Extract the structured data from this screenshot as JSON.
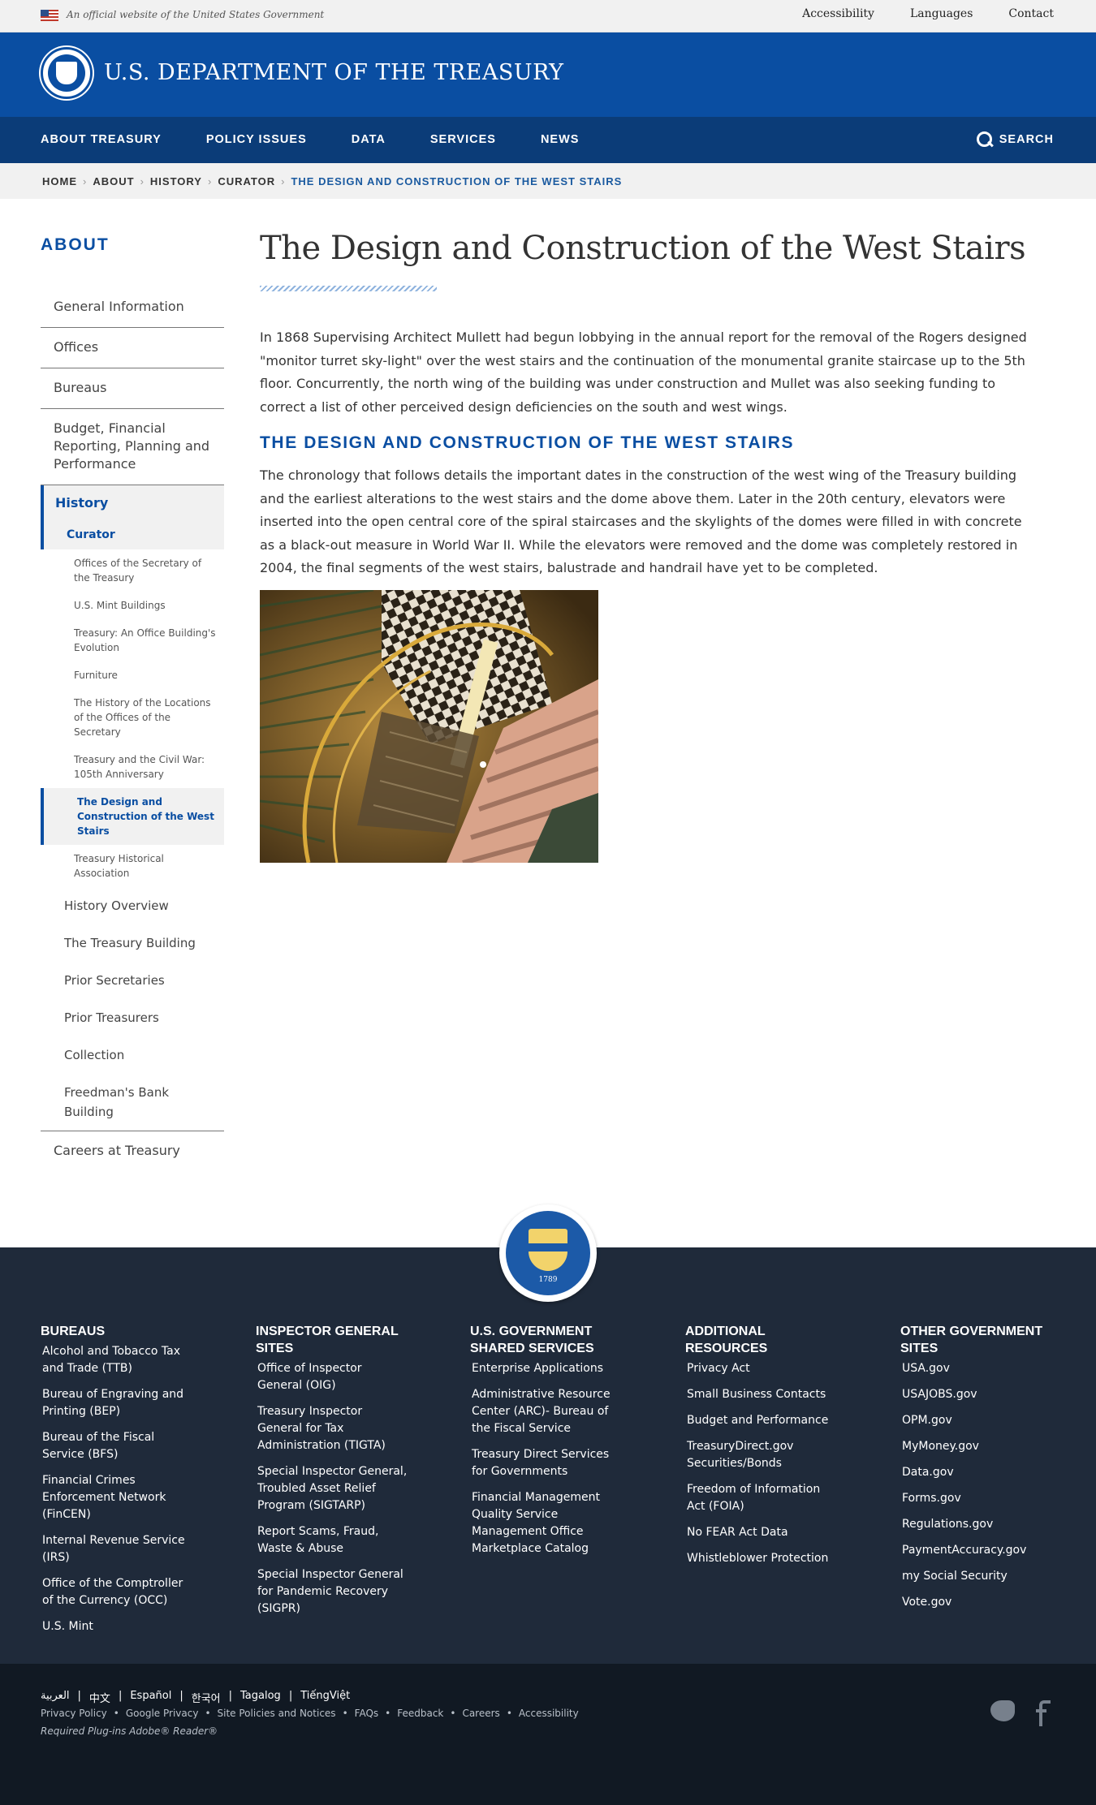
{
  "utility": {
    "official_text": "An official website of the United States Government",
    "links": [
      "Accessibility",
      "Languages",
      "Contact"
    ]
  },
  "header": {
    "site_title": "U.S. DEPARTMENT OF THE TREASURY"
  },
  "nav": {
    "items": [
      "ABOUT TREASURY",
      "POLICY ISSUES",
      "DATA",
      "SERVICES",
      "NEWS"
    ],
    "search_label": "SEARCH"
  },
  "breadcrumb": {
    "items": [
      "HOME",
      "ABOUT",
      "HISTORY",
      "CURATOR"
    ],
    "current": "THE DESIGN AND CONSTRUCTION OF THE WEST STAIRS"
  },
  "sidebar": {
    "title": "ABOUT",
    "level1": [
      "General Information",
      "Offices",
      "Bureaus",
      "Budget, Financial Reporting, Planning and Performance"
    ],
    "history": "History",
    "curator": "Curator",
    "curator_children": [
      "Offices of the Secretary of the Treasury",
      "U.S. Mint Buildings",
      "Treasury: An Office Building's Evolution",
      "Furniture",
      "The History of the Locations of the Offices of the Secretary",
      "Treasury and the Civil War: 105th Anniversary",
      "The Design and Construction of the West Stairs",
      "Treasury Historical Association"
    ],
    "history_children": [
      "History Overview",
      "The Treasury Building",
      "Prior Secretaries",
      "Prior Treasurers",
      "Collection",
      "Freedman's Bank Building"
    ],
    "careers": "Careers at Treasury"
  },
  "main": {
    "title": "The Design and Construction of the West Stairs",
    "intro": "In 1868 Supervising Architect Mullett had begun lobbying in the annual report for the removal of the Rogers designed \"monitor turret sky-light\" over the west stairs and the continuation of the monumental granite staircase up to the 5th floor. Concurrently, the north wing of the building was under construction and Mullet was also seeking funding to correct a list of other perceived design deficiencies on the south and west wings.",
    "section_heading": "THE DESIGN AND CONSTRUCTION OF THE WEST STAIRS",
    "body": "The chronology that follows details the important dates in the construction of the west wing of the Treasury building and the earliest alterations to the west stairs and the dome above them. Later in the 20th century, elevators were inserted into the open central core of the spiral staircases and the skylights of the domes were filled in with concrete as a black-out measure in World War II. While the elevators were removed and the dome was completely restored in 2004, the final segments of the west stairs, balustrade and handrail have yet to be completed."
  },
  "footer": {
    "seal_year": "1789",
    "columns": [
      {
        "heading": "BUREAUS",
        "links": [
          "Alcohol and Tobacco Tax and Trade (TTB)",
          "Bureau of Engraving and Printing (BEP)",
          "Bureau of the Fiscal Service (BFS)",
          "Financial Crimes Enforcement Network (FinCEN)",
          "Internal Revenue Service (IRS)",
          "Office of the Comptroller of the Currency (OCC)",
          "U.S. Mint"
        ]
      },
      {
        "heading": "INSPECTOR GENERAL SITES",
        "links": [
          "Office of Inspector General (OIG)",
          "Treasury Inspector General for Tax Administration (TIGTA)",
          "Special Inspector General, Troubled Asset Relief Program (SIGTARP)",
          "Report Scams, Fraud, Waste & Abuse",
          "Special Inspector General for Pandemic Recovery (SIGPR)"
        ]
      },
      {
        "heading": "U.S. GOVERNMENT SHARED SERVICES",
        "links": [
          "Enterprise Applications",
          "Administrative Resource Center (ARC)- Bureau of the Fiscal Service",
          "Treasury Direct Services for Governments",
          "Financial Management Quality Service Management Office Marketplace Catalog"
        ]
      },
      {
        "heading": "ADDITIONAL RESOURCES",
        "links": [
          "Privacy Act",
          "Small Business Contacts",
          "Budget and Performance",
          "TreasuryDirect.gov Securities/Bonds",
          "Freedom of Information Act (FOIA)",
          "No FEAR Act Data",
          "Whistleblower Protection"
        ]
      },
      {
        "heading": "OTHER GOVERNMENT SITES",
        "links": [
          "USA.gov",
          "USAJOBS.gov",
          "OPM.gov",
          "MyMoney.gov",
          "Data.gov",
          "Forms.gov",
          "Regulations.gov",
          "PaymentAccuracy.gov",
          "my Social Security",
          "Vote.gov"
        ]
      }
    ]
  },
  "subfooter": {
    "languages": [
      "العربية",
      "中文",
      "Español",
      "한국어",
      "Tagalog",
      "TiếngViệt"
    ],
    "legal": [
      "Privacy Policy",
      "Google Privacy",
      "Site Policies and Notices",
      "FAQs",
      "Feedback",
      "Careers",
      "Accessibility"
    ],
    "plugins_label": "Required Plug-ins",
    "plugins_value": "Adobe® Reader®"
  }
}
